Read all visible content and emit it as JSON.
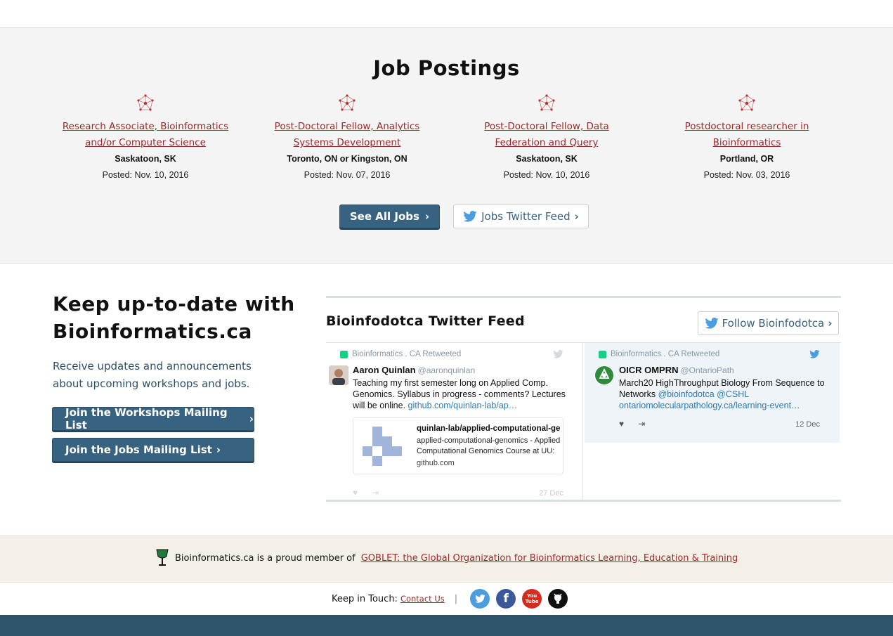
{
  "jobs": {
    "title": "Job Postings",
    "items": [
      {
        "title_line1": "Research Associate, Bioinformatics",
        "title_line2": "and/or Computer Science",
        "location": "Saskatoon, SK",
        "posted": "Posted: Nov. 10, 2016"
      },
      {
        "title_line1": "Post-Doctoral Fellow, Analytics",
        "title_line2": "Systems Development",
        "location": "Toronto, ON or Kingston, ON",
        "posted": "Posted: Nov. 07, 2016"
      },
      {
        "title_line1": "Post-Doctoral Fellow, Data",
        "title_line2": "Federation and Query",
        "location": "Saskatoon, SK",
        "posted": "Posted: Nov. 10, 2016"
      },
      {
        "title_line1": "Postdoctoral researcher in",
        "title_line2": "Bioinformatics",
        "location": "Portland, OR",
        "posted": "Posted: Nov. 03, 2016"
      }
    ],
    "see_all_label": "See All Jobs",
    "twitter_feed_label": "Jobs Twitter Feed"
  },
  "newsletter": {
    "title_line1": "Keep up-to-date with",
    "title_line2": "Bioinformatics.ca",
    "text": "Receive updates and announcements about upcoming workshops and jobs.",
    "workshops_button": "Join the Workshops Mailing List",
    "jobs_button": "Join the Jobs Mailing List"
  },
  "feed": {
    "title": "Bioinfodotca Twitter Feed",
    "follow_label": "Follow Bioinfodotca",
    "tweets": [
      {
        "retweet_line": "Bioinformatics . CA Retweeted",
        "name": "Aaron Quinlan",
        "handle": "@aaronquinlan",
        "body": "Teaching my first semester long on Applied Comp. Genomics. Syllabus in progress - comments? Lectures will be online.",
        "link": "github.com/quinlan-lab/ap…",
        "card_title": "quinlan-lab/applied-computational-ge...",
        "card_desc": "applied-computational-genomics - Applied Computational Genomics Course at UU:",
        "card_domain": "github.com",
        "date": "27 Dec"
      },
      {
        "retweet_line": "Bioinformatics . CA Retweeted",
        "name": "OICR OMPRN",
        "handle": "@OntarioPath",
        "body": "March20 HighThroughput Biology From Sequence to Networks",
        "mention1": "@bioinfodotca",
        "mention2": "@CSHL",
        "link": "ontariomolecularpathology.ca/learning-event…",
        "date": "12 Dec"
      }
    ]
  },
  "goblet": {
    "text": "Bioinformatics.ca is a proud member of",
    "link": "GOBLET: the Global Organization for Bioinformatics Learning, Education & Training"
  },
  "footer": {
    "keep_label": "Keep in Touch:",
    "contact_label": "Contact Us",
    "separator": "|",
    "youtube_text": "You Tube"
  },
  "colors": {
    "brand_blue": "#386380",
    "link_red": "#9c2a2a",
    "twitter_blue": "#4a9ee0",
    "facebook_blue": "#3b5998",
    "youtube_red": "#d52c1f"
  }
}
